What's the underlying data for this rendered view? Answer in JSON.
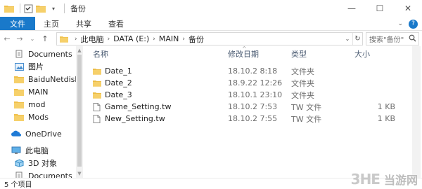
{
  "window": {
    "title": "备份",
    "controls": {
      "minimize": "—",
      "maximize": "☐",
      "close": "✕"
    }
  },
  "ribbon": {
    "tabs": [
      "文件",
      "主页",
      "共享",
      "查看"
    ],
    "help": "?"
  },
  "address": {
    "crumbs": [
      "此电脑",
      "DATA (E:)",
      "MAIN",
      "备份"
    ],
    "search_placeholder": "搜索\"备份\""
  },
  "nav": {
    "items": [
      {
        "label": "Documents",
        "icon": "documents-icon",
        "pinned": true
      },
      {
        "label": "图片",
        "icon": "pictures-icon",
        "pinned": true
      },
      {
        "label": "BaiduNetdiskDo",
        "icon": "folder-icon",
        "pinned": false
      },
      {
        "label": "MAIN",
        "icon": "folder-icon",
        "pinned": false
      },
      {
        "label": "mod",
        "icon": "folder-icon",
        "pinned": false
      },
      {
        "label": "Mods",
        "icon": "folder-icon",
        "pinned": false
      },
      {
        "label": "OneDrive",
        "icon": "onedrive-icon",
        "pinned": false
      },
      {
        "label": "此电脑",
        "icon": "this-pc-icon",
        "pinned": false
      },
      {
        "label": "3D 对象",
        "icon": "3d-objects-icon",
        "pinned": false
      },
      {
        "label": "Documents",
        "icon": "documents-icon",
        "pinned": false
      }
    ]
  },
  "columns": {
    "name": "名称",
    "date": "修改日期",
    "type": "类型",
    "size": "大小"
  },
  "files": [
    {
      "name": "Date_1",
      "date": "18.10.2 8:18",
      "type": "文件夹",
      "size": "",
      "kind": "folder"
    },
    {
      "name": "Date_2",
      "date": "18.9.22 12:26",
      "type": "文件夹",
      "size": "",
      "kind": "folder"
    },
    {
      "name": "Date_3",
      "date": "18.10.1 23:10",
      "type": "文件夹",
      "size": "",
      "kind": "folder"
    },
    {
      "name": "Game_Setting.tw",
      "date": "18.10.2 7:53",
      "type": "TW 文件",
      "size": "1 KB",
      "kind": "file"
    },
    {
      "name": "New_Setting.tw",
      "date": "18.10.2 7:55",
      "type": "TW 文件",
      "size": "1 KB",
      "kind": "file"
    }
  ],
  "status": {
    "count": "5 个项目"
  },
  "watermark": {
    "logo": "3HE",
    "text": "当游网"
  },
  "colors": {
    "accent": "#1979ca",
    "folder": "#f0c04a",
    "header_text": "#4a5b72"
  }
}
